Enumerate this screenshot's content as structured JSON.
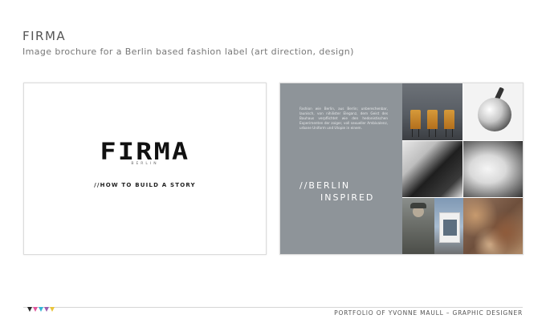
{
  "header": {
    "title": "FIRMA",
    "subtitle": "Image brochure for a Berlin based fashion label (art direction, design)"
  },
  "cover": {
    "logo": "FIRMA",
    "logo_sub": "BERLIN",
    "tagline": "//HOW TO BUILD A STORY"
  },
  "spread": {
    "body_text": "Fashion wie Berlin, aus Berlin; unberechenbar, launisch, von nihilister Eleganz, dem Geist des Bauhaus verpflichtet wie den hedonistischen Experimenten der zoiger, voll sexueller Ambivalenz, urbane Uniform und Utopie in einem.",
    "heading_line1": "//BERLIN",
    "heading_line2": "INSPIRED",
    "panel_color": "#8e9499",
    "photos": [
      {
        "name": "orange-chairs-photo"
      },
      {
        "name": "chrome-decanter-photo"
      },
      {
        "name": "couple-photo"
      },
      {
        "name": "sleeping-woman-photo"
      },
      {
        "name": "soldier-photo"
      },
      {
        "name": "modern-building-photo"
      },
      {
        "name": "rusted-texture-photo"
      }
    ]
  },
  "footer": {
    "text": "PORTFOLIO OF YVONNE MAULL – GRAPHIC DESIGNER",
    "triangle_colors": [
      "#2b2b2b",
      "#e0559b",
      "#33b5d6",
      "#9a5fb0",
      "#e9c43a"
    ]
  }
}
